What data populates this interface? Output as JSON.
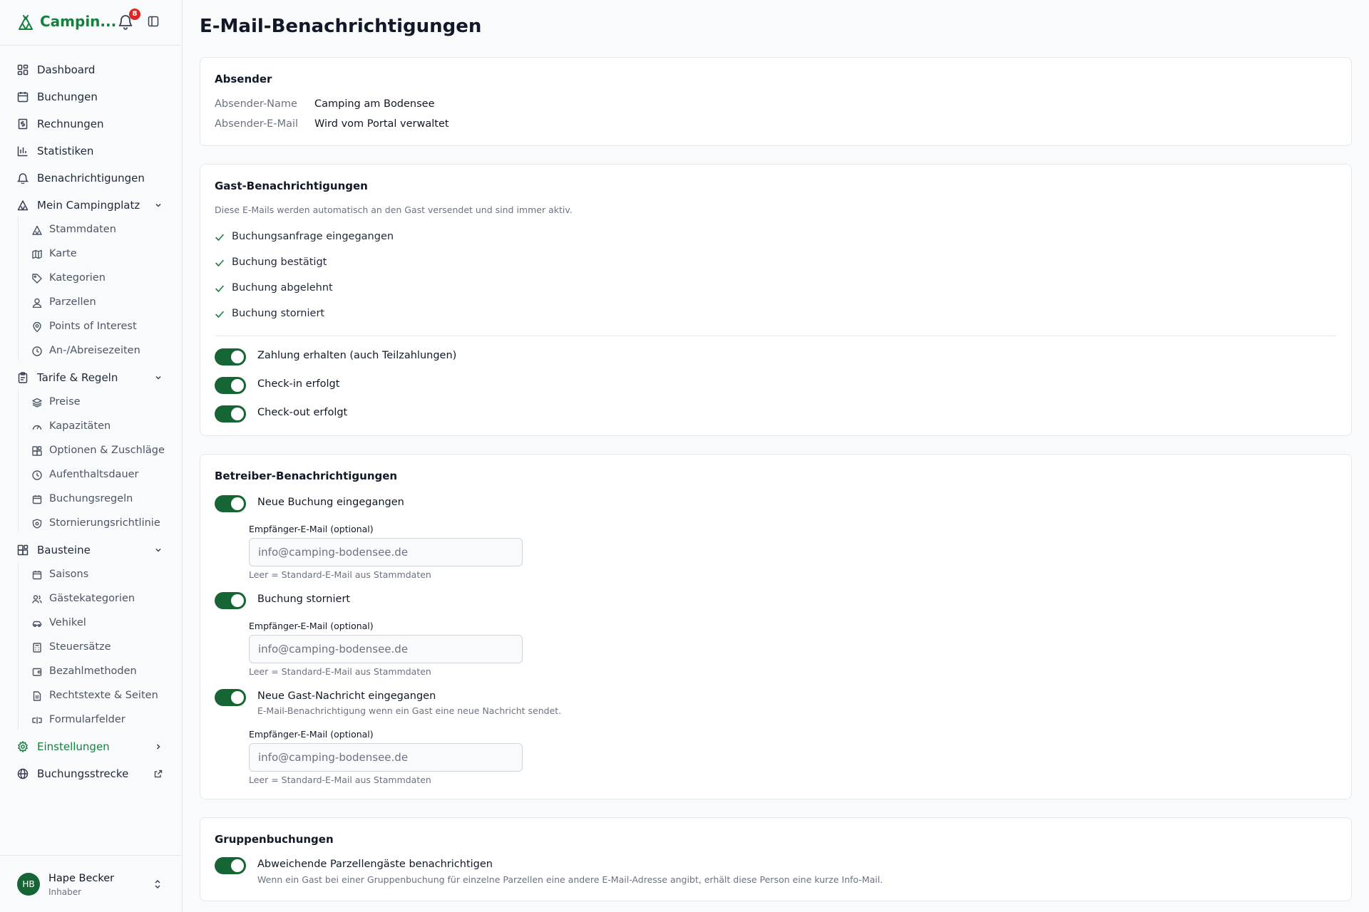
{
  "app": {
    "name": "Campin...",
    "notification_count": "8"
  },
  "nav": {
    "dashboard": "Dashboard",
    "bookings": "Buchungen",
    "invoices": "Rechnungen",
    "statistics": "Statistiken",
    "notifications": "Benachrichtigungen",
    "my_campsite": {
      "label": "Mein Campingplatz",
      "items": [
        "Stammdaten",
        "Karte",
        "Kategorien",
        "Parzellen",
        "Points of Interest",
        "An-/Abreisezeiten"
      ]
    },
    "rates_rules": {
      "label": "Tarife & Regeln",
      "items": [
        "Preise",
        "Kapazitäten",
        "Optionen & Zuschläge",
        "Aufenthaltsdauer",
        "Buchungsregeln",
        "Stornierungsrichtlinie"
      ]
    },
    "modules": {
      "label": "Bausteine",
      "items": [
        "Saisons",
        "Gästekategorien",
        "Vehikel",
        "Steuersätze",
        "Bezahlmethoden",
        "Rechtstexte & Seiten",
        "Formularfelder"
      ]
    },
    "settings": "Einstellungen",
    "booking_route": "Buchungsstrecke"
  },
  "user": {
    "initials": "HB",
    "name": "Hape Becker",
    "role": "Inhaber"
  },
  "page": {
    "title": "E-Mail-Benachrichtigungen"
  },
  "sender": {
    "title": "Absender",
    "name_label": "Absender-Name",
    "name_value": "Camping am Bodensee",
    "email_label": "Absender-E-Mail",
    "email_value": "Wird vom Portal verwaltet"
  },
  "guest": {
    "title": "Gast-Benachrichtigungen",
    "description": "Diese E-Mails werden automatisch an den Gast versendet und sind immer aktiv.",
    "always_on": [
      "Buchungsanfrage eingegangen",
      "Buchung bestätigt",
      "Buchung abgelehnt",
      "Buchung storniert"
    ],
    "toggles": [
      {
        "label": "Zahlung erhalten (auch Teilzahlungen)",
        "on": true
      },
      {
        "label": "Check-in erfolgt",
        "on": true
      },
      {
        "label": "Check-out erfolgt",
        "on": true
      }
    ]
  },
  "operator": {
    "title": "Betreiber-Benachrichtigungen",
    "field_label": "Empfänger-E-Mail (optional)",
    "field_placeholder": "info@camping-bodensee.de",
    "field_help": "Leer = Standard-E-Mail aus Stammdaten",
    "items": [
      {
        "label": "Neue Buchung eingegangen",
        "on": true
      },
      {
        "label": "Buchung storniert",
        "on": true
      },
      {
        "label": "Neue Gast-Nachricht eingegangen",
        "help": "E-Mail-Benachrichtigung wenn ein Gast eine neue Nachricht sendet.",
        "on": true
      }
    ]
  },
  "group": {
    "title": "Gruppenbuchungen",
    "toggle_label": "Abweichende Parzellengäste benachrichtigen",
    "toggle_help": "Wenn ein Gast bei einer Gruppenbuchung für einzelne Parzellen eine andere E-Mail-Adresse angibt, erhält diese Person eine kurze Info-Mail.",
    "on": true
  },
  "colors": {
    "brand": "#15803d",
    "toggle_on": "#166534",
    "badge": "#dc2626"
  }
}
